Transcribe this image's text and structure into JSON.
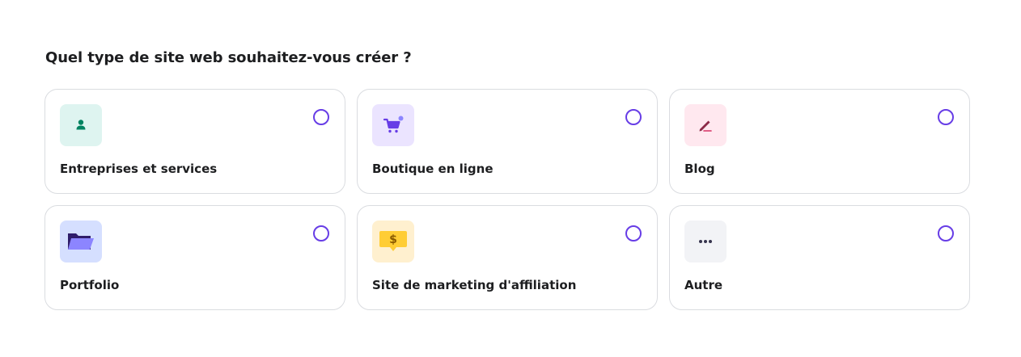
{
  "question": "Quel type de site web souhaitez-vous créer ?",
  "colors": {
    "radio_border": "#673de6",
    "card_border": "#dadce0"
  },
  "options": [
    {
      "label": "Entreprises et services",
      "icon": "person-icon",
      "icon_bg": "#def4f0",
      "icon_color": "#008361"
    },
    {
      "label": "Boutique en ligne",
      "icon": "shopping-cart-icon",
      "icon_bg": "#ebe4ff",
      "icon_color": "#673de6"
    },
    {
      "label": "Blog",
      "icon": "pen-icon",
      "icon_bg": "#ffe8ef",
      "icon_color": "#8c2b48"
    },
    {
      "label": "Portfolio",
      "icon": "folder-icon",
      "icon_bg": "#d5dfff",
      "icon_color": "#8c85ff"
    },
    {
      "label": "Site de marketing d'affiliation",
      "icon": "dollar-tag-icon",
      "icon_bg": "#fff0cf",
      "icon_color": "#ffcd35"
    },
    {
      "label": "Autre",
      "icon": "more-dots-icon",
      "icon_bg": "#f2f3f6",
      "icon_color": "#36344d"
    }
  ]
}
